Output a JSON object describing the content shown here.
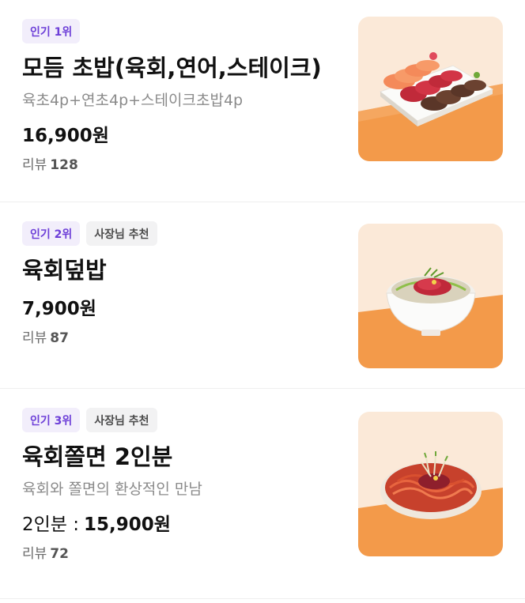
{
  "menu_items": [
    {
      "rank_badge": "인기 1위",
      "recommend_badge": "",
      "title": "모듬 초밥(육회,연어,스테이크)",
      "description": "육초4p+연초4p+스테이크초밥4p",
      "price_prefix": "",
      "price": "16,900원",
      "review_label": "리뷰",
      "review_count": "128",
      "image_icon": "sushi-platter-image"
    },
    {
      "rank_badge": "인기 2위",
      "recommend_badge": "사장님 추천",
      "title": "육회덮밥",
      "description": "",
      "price_prefix": "",
      "price": "7,900원",
      "review_label": "리뷰",
      "review_count": "87",
      "image_icon": "yukhoe-rice-bowl-image"
    },
    {
      "rank_badge": "인기 3위",
      "recommend_badge": "사장님 추천",
      "title": "육회쫄면 2인분",
      "description": "육회와 쫄면의 환상적인 만남",
      "price_prefix": "2인분 :",
      "price": "15,900원",
      "review_label": "리뷰",
      "review_count": "72",
      "image_icon": "yukhoe-jjolmyeon-image"
    }
  ],
  "colors": {
    "rank_badge_text": "#6d3fd8",
    "rank_badge_bg": "#f2eefb",
    "photo_background_orange": "#f39a4a"
  }
}
